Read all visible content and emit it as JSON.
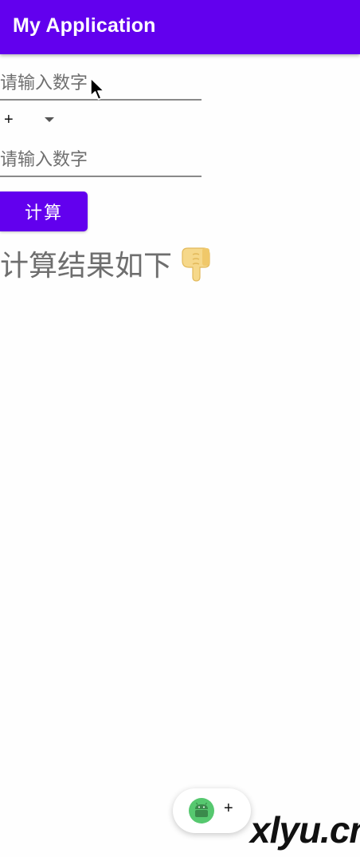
{
  "app_bar": {
    "title": "My Application",
    "color": "#6200ee"
  },
  "form": {
    "first_number": {
      "value": "",
      "placeholder": "请输入数字"
    },
    "operator": {
      "selected": "+"
    },
    "second_number": {
      "value": "",
      "placeholder": "请输入数字"
    },
    "calculate_label": "计算"
  },
  "result": {
    "text": "计算结果如下",
    "icon": "pointing-down-hand-icon"
  },
  "floating_panel": {
    "icon": "android-icon",
    "plus_label": "+"
  },
  "watermark": "xlyu.cn",
  "colors": {
    "accent": "#6200ee",
    "background": "#fefefe",
    "muted_text": "#6e6e6e"
  }
}
